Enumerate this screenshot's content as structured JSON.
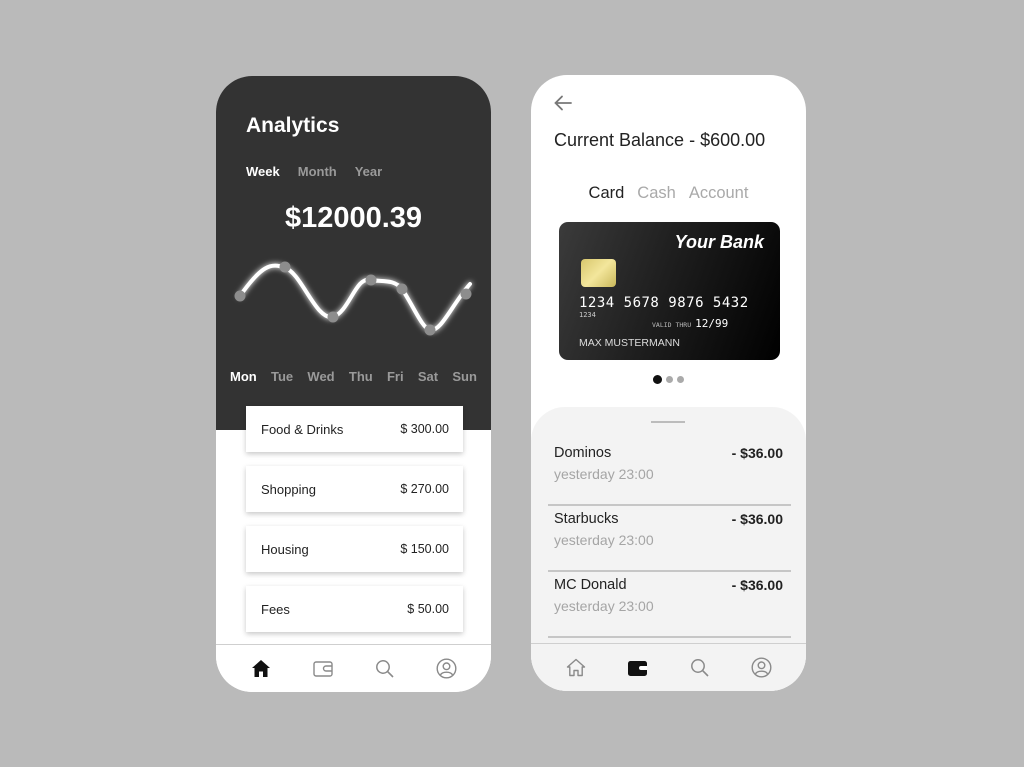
{
  "analytics": {
    "title": "Analytics",
    "periods": [
      {
        "label": "Week",
        "active": true
      },
      {
        "label": "Month",
        "active": false
      },
      {
        "label": "Year",
        "active": false
      }
    ],
    "total": "$12000.39",
    "days": [
      {
        "label": "Mon",
        "active": true
      },
      {
        "label": "Tue",
        "active": false
      },
      {
        "label": "Wed",
        "active": false
      },
      {
        "label": "Thu",
        "active": false
      },
      {
        "label": "Fri",
        "active": false
      },
      {
        "label": "Sat",
        "active": false
      },
      {
        "label": "Sun",
        "active": false
      }
    ],
    "categories": [
      {
        "name": "Food & Drinks",
        "amount": "$ 300.00"
      },
      {
        "name": "Shopping",
        "amount": "$ 270.00"
      },
      {
        "name": "Housing",
        "amount": "$ 150.00"
      },
      {
        "name": "Fees",
        "amount": "$ 50.00"
      }
    ],
    "tabbar": [
      {
        "icon": "home-icon",
        "active": true
      },
      {
        "icon": "wallet-icon",
        "active": false
      },
      {
        "icon": "search-icon",
        "active": false
      },
      {
        "icon": "profile-icon",
        "active": false
      }
    ]
  },
  "balance": {
    "back_icon": "arrow-left-icon",
    "title": "Current Balance - $600.00",
    "tabs": [
      {
        "label": "Card",
        "active": true
      },
      {
        "label": "Cash",
        "active": false
      },
      {
        "label": "Account",
        "active": false
      }
    ],
    "card": {
      "bank": "Your Bank",
      "number": "1234 5678 9876 5432",
      "small_number": "1234",
      "expiry_label": "VALID THRU",
      "expiry": "12/99",
      "holder": "MAX MUSTERMANN"
    },
    "carousel": {
      "count": 3,
      "active": 0
    },
    "transactions": [
      {
        "name": "Dominos",
        "time": "yesterday 23:00",
        "amount": "- $36.00"
      },
      {
        "name": "Starbucks",
        "time": "yesterday 23:00",
        "amount": "- $36.00"
      },
      {
        "name": "MC Donald",
        "time": "yesterday 23:00",
        "amount": "- $36.00"
      }
    ],
    "tabbar": [
      {
        "icon": "home-icon",
        "active": false
      },
      {
        "icon": "wallet-icon",
        "active": true
      },
      {
        "icon": "search-icon",
        "active": false
      },
      {
        "icon": "profile-icon",
        "active": false
      }
    ]
  },
  "colors": {
    "background": "#bababa",
    "dark_panel": "#333333",
    "accent_light": "#ffffff",
    "muted_text": "#9a9a9a",
    "sheet": "#f3f3f3"
  }
}
